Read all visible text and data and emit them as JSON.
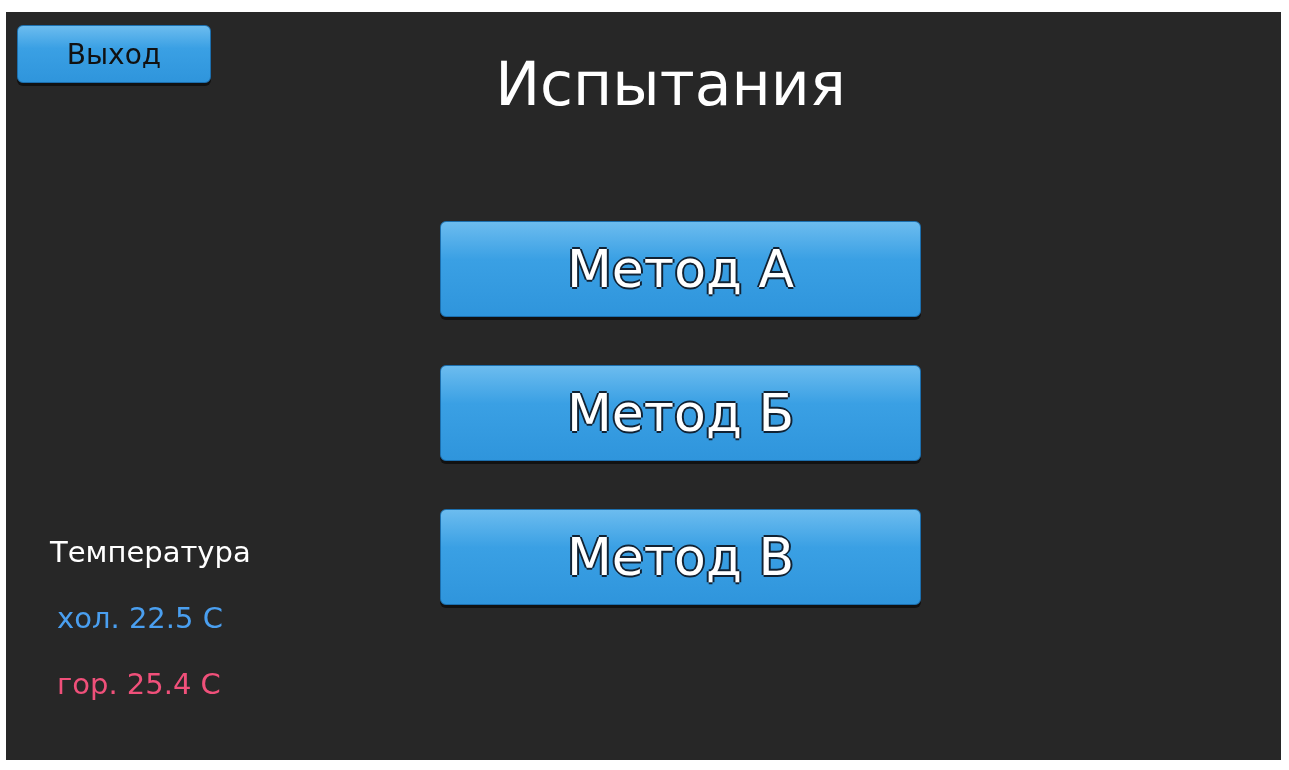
{
  "exit_button": {
    "label": "Выход"
  },
  "title": "Испытания",
  "method_buttons": [
    {
      "label": "Метод А"
    },
    {
      "label": "Метод Б"
    },
    {
      "label": "Метод В"
    }
  ],
  "temperature": {
    "label": "Температура",
    "readings": [
      {
        "text": "хол. 22.5 C",
        "color": "#4a9ff0"
      },
      {
        "text": "гор. 25.4 C",
        "color": "#f0507a"
      }
    ]
  }
}
